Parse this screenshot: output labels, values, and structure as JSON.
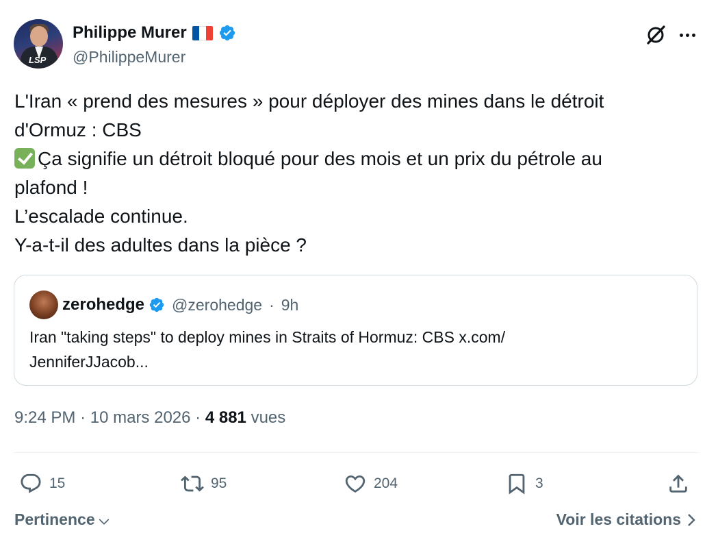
{
  "author": {
    "name": "Philippe Murer",
    "handle": "@PhilippeMurer",
    "avatar_logo": "LSP",
    "flag_colors": [
      "#0055a4",
      "#ffffff",
      "#ef4135"
    ]
  },
  "tweet": {
    "lines": [
      "L'Iran « prend des mesures » pour déployer des mines dans le détroit",
      "d'Ormuz : CBS",
      "Ça signifie un détroit bloqué pour des mois et un prix du pétrole au",
      "plafond !",
      "L’escalade continue.",
      "Y-a-t-il des adultes dans la pièce ?"
    ]
  },
  "quote": {
    "name": "zerohedge",
    "handle": "@zerohedge",
    "separator": "·",
    "time": "9h",
    "lines": [
      "Iran \"taking steps\" to deploy mines in Straits of Hormuz: CBS x.com/",
      "JenniferJJacob..."
    ]
  },
  "meta": {
    "time": "9:24 PM",
    "sep1": "·",
    "date": "10 mars 2026",
    "sep2": "·",
    "views_count": "4 881",
    "views_label": "vues"
  },
  "actions": {
    "replies": "15",
    "reposts": "95",
    "likes": "204",
    "bookmarks": "3"
  },
  "footer": {
    "sort_label": "Pertinence",
    "quotes_label": "Voir les citations"
  },
  "colors": {
    "text": "#0f1419",
    "secondary": "#536471",
    "verified": "#1d9bf0",
    "border": "#cfd9de",
    "check_emoji": "#78b159"
  },
  "icons": [
    "verified-badge-icon",
    "grok-icon",
    "more-icon",
    "reply-icon",
    "repost-icon",
    "like-icon",
    "bookmark-icon",
    "share-icon",
    "chevron-down-icon",
    "chevron-right-icon",
    "check-mark-emoji"
  ]
}
